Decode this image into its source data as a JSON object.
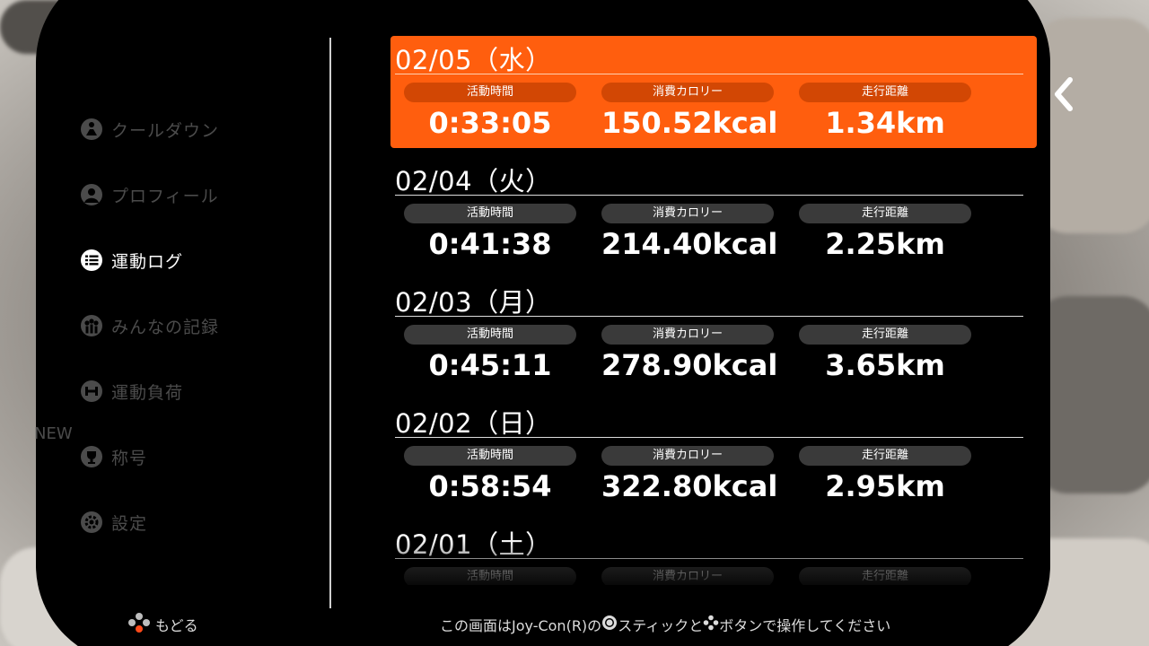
{
  "sidebar": {
    "items": [
      {
        "label": "クールダウン",
        "icon": "cooldown-icon",
        "active": false
      },
      {
        "label": "プロフィール",
        "icon": "profile-icon",
        "active": false
      },
      {
        "label": "運動ログ",
        "icon": "log-list-icon",
        "active": true
      },
      {
        "label": "みんなの記録",
        "icon": "group-icon",
        "active": false
      },
      {
        "label": "運動負荷",
        "icon": "dumbbell-icon",
        "active": false
      },
      {
        "label": "称号",
        "icon": "trophy-icon",
        "active": false
      },
      {
        "label": "設定",
        "icon": "gear-icon",
        "active": false
      }
    ],
    "new_badge": "NEW"
  },
  "log": {
    "stat_labels": {
      "time": "活動時間",
      "calories": "消費カロリー",
      "distance": "走行距離"
    },
    "entries": [
      {
        "date": "02/05（水）",
        "time": "0:33:05",
        "calories": "150.52kcal",
        "distance": "1.34km",
        "selected": true
      },
      {
        "date": "02/04（火）",
        "time": "0:41:38",
        "calories": "214.40kcal",
        "distance": "2.25km",
        "selected": false
      },
      {
        "date": "02/03（月）",
        "time": "0:45:11",
        "calories": "278.90kcal",
        "distance": "3.65km",
        "selected": false
      },
      {
        "date": "02/02（日）",
        "time": "0:58:54",
        "calories": "322.80kcal",
        "distance": "2.95km",
        "selected": false
      },
      {
        "date": "02/01（土）",
        "time": "",
        "calories": "",
        "distance": "",
        "selected": false
      }
    ]
  },
  "footer": {
    "back_label": "もどる",
    "hint_part1": "この画面はJoy-Con(R)の",
    "hint_part2": "スティックと",
    "hint_part3": "ボタンで操作してください"
  },
  "colors": {
    "accent": "#ff5e0e",
    "accent_dark": "#d24704",
    "pill": "#3a3a3a",
    "inactive_text": "#4b4b4b"
  }
}
